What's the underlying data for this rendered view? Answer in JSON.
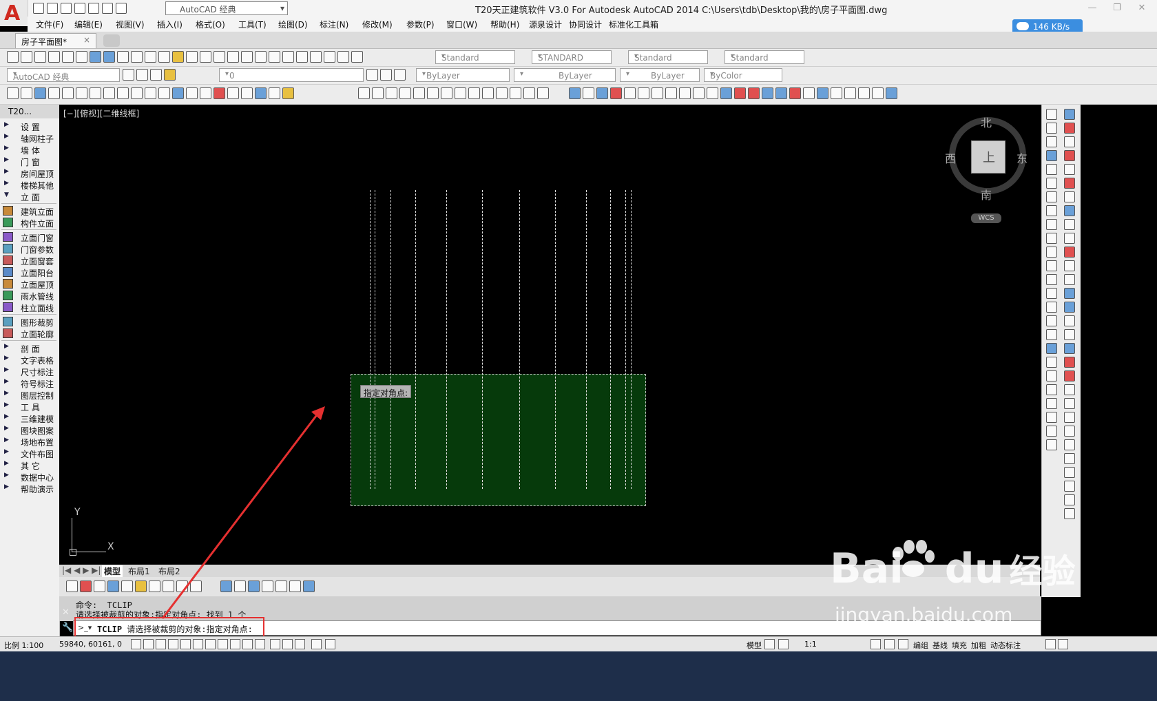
{
  "app": {
    "logo_letter": "A",
    "workspace": "AutoCAD 经典",
    "title": "T20天正建筑软件 V3.0 For Autodesk AutoCAD 2014    C:\\Users\\tdb\\Desktop\\我的\\房子平面图.dwg"
  },
  "menubar": {
    "items": [
      "文件(F)",
      "编辑(E)",
      "视图(V)",
      "插入(I)",
      "格式(O)",
      "工具(T)",
      "绘图(D)",
      "标注(N)",
      "修改(M)",
      "参数(P)",
      "窗口(W)",
      "帮助(H)",
      "源泉设计",
      "协同设计",
      "标准化工具箱"
    ]
  },
  "speed": "146 KB/s",
  "doc_tab": {
    "label": "房子平面图*",
    "close": "×"
  },
  "toolbar1": {
    "styles": [
      "Standard",
      "STANDARD",
      "Standard",
      "Standard"
    ]
  },
  "toolbar2": {
    "workspace_combo": "AutoCAD 经典",
    "layer_combo": "0",
    "color_combo": "ByLayer",
    "linetype_combo": "ByLayer",
    "lineweight_combo": "ByLayer",
    "plotstyle_combo": "ByColor"
  },
  "left_panel": {
    "title": "T20...",
    "items": [
      {
        "label": "设    置",
        "kind": "arrow"
      },
      {
        "label": "轴网柱子",
        "kind": "arrow"
      },
      {
        "label": "墙    体",
        "kind": "arrow"
      },
      {
        "label": "门    窗",
        "kind": "arrow"
      },
      {
        "label": "房间屋顶",
        "kind": "arrow"
      },
      {
        "label": "楼梯其他",
        "kind": "arrow"
      },
      {
        "label": "立    面",
        "kind": "open"
      },
      {
        "label": "建筑立面",
        "kind": "icon"
      },
      {
        "label": "构件立面",
        "kind": "icon"
      },
      {
        "label": "立面门窗",
        "kind": "icon"
      },
      {
        "label": "门窗参数",
        "kind": "icon"
      },
      {
        "label": "立面窗套",
        "kind": "icon"
      },
      {
        "label": "立面阳台",
        "kind": "icon"
      },
      {
        "label": "立面屋顶",
        "kind": "icon"
      },
      {
        "label": "雨水管线",
        "kind": "icon"
      },
      {
        "label": "柱立面线",
        "kind": "icon"
      },
      {
        "label": "图形裁剪",
        "kind": "icon"
      },
      {
        "label": "立面轮廓",
        "kind": "icon"
      },
      {
        "label": "剖    面",
        "kind": "arrow"
      },
      {
        "label": "文字表格",
        "kind": "arrow"
      },
      {
        "label": "尺寸标注",
        "kind": "arrow"
      },
      {
        "label": "符号标注",
        "kind": "arrow"
      },
      {
        "label": "图层控制",
        "kind": "arrow"
      },
      {
        "label": "工    具",
        "kind": "arrow"
      },
      {
        "label": "三维建模",
        "kind": "arrow"
      },
      {
        "label": "图块图案",
        "kind": "arrow"
      },
      {
        "label": "场地布置",
        "kind": "arrow"
      },
      {
        "label": "文件布图",
        "kind": "arrow"
      },
      {
        "label": "其    它",
        "kind": "arrow"
      },
      {
        "label": "数据中心",
        "kind": "arrow"
      },
      {
        "label": "帮助演示",
        "kind": "arrow"
      }
    ]
  },
  "canvas": {
    "view_label": "[−][俯视][二维线框]",
    "tooltip": "指定对角点:",
    "viewcube": {
      "north": "北",
      "south": "南",
      "east": "东",
      "west": "西",
      "top_face": "上",
      "wcs": "WCS"
    },
    "ucs": {
      "x": "X",
      "y": "Y"
    }
  },
  "layout_tabs": [
    "模型",
    "布局1",
    "布局2"
  ],
  "command": {
    "history": [
      "命令:  TCLIP",
      "请选择被裁剪的对象:指定对角点: 找到 1 个"
    ],
    "cmd_name": "TCLIP",
    "prompt": " 请选择被裁剪的对象:指定对角点:"
  },
  "statusbar": {
    "scale": "比例 1:100",
    "coords": "59840, 60161, 0",
    "model": "模型",
    "anno_scale": "1:1",
    "right_items": [
      "编组",
      "基线",
      "填充",
      "加粗",
      "动态标注"
    ]
  },
  "watermark": {
    "brand": "Bai",
    "brand2": "du",
    "brand3": "经验",
    "url": "jingyan.baidu.com"
  }
}
